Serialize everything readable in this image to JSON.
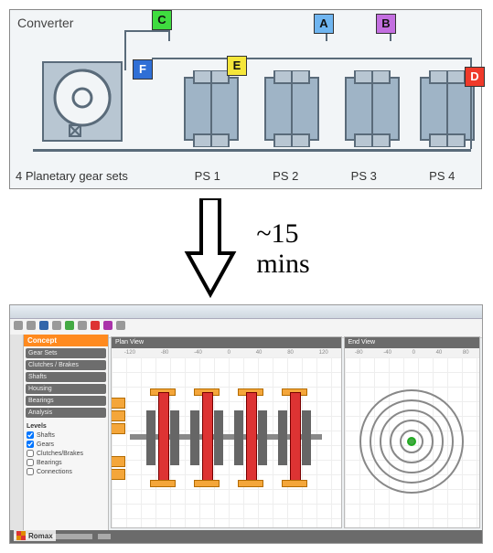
{
  "top": {
    "title": "Converter",
    "badges": {
      "A": "A",
      "B": "B",
      "C": "C",
      "D": "D",
      "E": "E",
      "F": "F"
    },
    "bottom_main_label": "4 Planetary gear sets",
    "ps_labels": [
      "PS 1",
      "PS 2",
      "PS 3",
      "PS 4"
    ]
  },
  "transition": {
    "time": "~15",
    "unit": "mins"
  },
  "software": {
    "sidebar_header": "Concept",
    "sidebar_items": [
      "Gear Sets",
      "Clutches / Brakes",
      "Shafts",
      "Housing",
      "Bearings",
      "Analysis"
    ],
    "sidebar_section": "Levels",
    "sidebar_checks": [
      "Shafts",
      "Gears",
      "Clutches/Brakes",
      "Bearings",
      "Connections"
    ],
    "pane_left_title": "Plan View",
    "pane_right_title": "End View",
    "ruler_ticks_left": [
      "-120",
      "-80",
      "-40",
      "0",
      "40",
      "80",
      "120"
    ],
    "ruler_ticks_right": [
      "-80",
      "-40",
      "0",
      "40",
      "80"
    ],
    "brand": "Romax"
  }
}
